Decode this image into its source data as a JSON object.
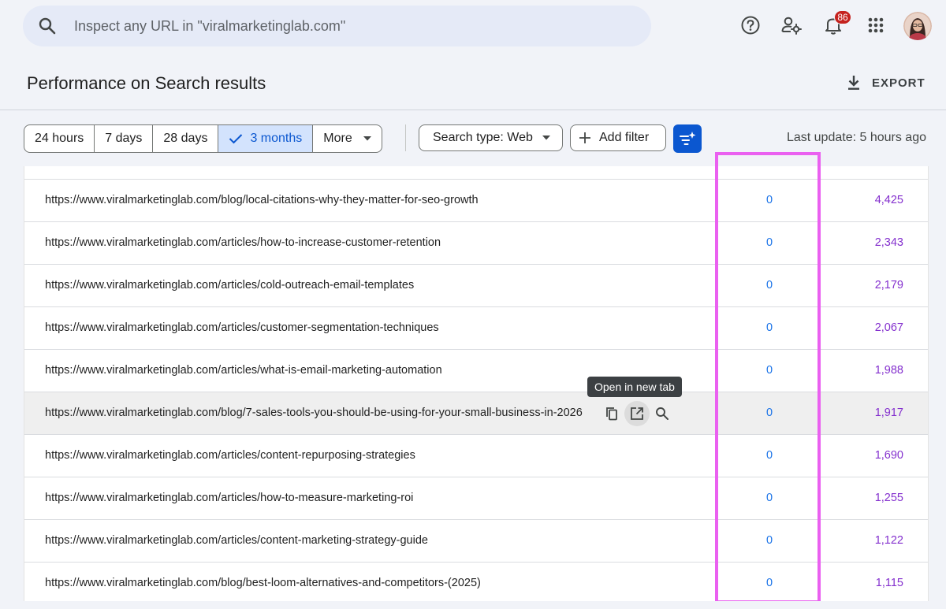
{
  "search": {
    "placeholder": "Inspect any URL in \"viralmarketinglab.com\""
  },
  "notifications": {
    "count": "86"
  },
  "header": {
    "title": "Performance on Search results",
    "export_label": "EXPORT"
  },
  "date_ranges": [
    {
      "label": "24 hours",
      "selected": false
    },
    {
      "label": "7 days",
      "selected": false
    },
    {
      "label": "28 days",
      "selected": false
    },
    {
      "label": "3 months",
      "selected": true
    },
    {
      "label": "More",
      "selected": false
    }
  ],
  "filters": {
    "search_type_label": "Search type: Web",
    "add_filter_label": "Add filter",
    "last_update": "Last update: 5 hours ago"
  },
  "tooltip": "Open in new tab",
  "rows": [
    {
      "url": "https://www.viralmarketinglab.com/blog/local-citations-why-they-matter-for-seo-growth",
      "clicks": "0",
      "impressions": "4,425"
    },
    {
      "url": "https://www.viralmarketinglab.com/articles/how-to-increase-customer-retention",
      "clicks": "0",
      "impressions": "2,343"
    },
    {
      "url": "https://www.viralmarketinglab.com/articles/cold-outreach-email-templates",
      "clicks": "0",
      "impressions": "2,179"
    },
    {
      "url": "https://www.viralmarketinglab.com/articles/customer-segmentation-techniques",
      "clicks": "0",
      "impressions": "2,067"
    },
    {
      "url": "https://www.viralmarketinglab.com/articles/what-is-email-marketing-automation",
      "clicks": "0",
      "impressions": "1,988"
    },
    {
      "url": "https://www.viralmarketinglab.com/blog/7-sales-tools-you-should-be-using-for-your-small-business-in-2026",
      "clicks": "0",
      "impressions": "1,917"
    },
    {
      "url": "https://www.viralmarketinglab.com/articles/content-repurposing-strategies",
      "clicks": "0",
      "impressions": "1,690"
    },
    {
      "url": "https://www.viralmarketinglab.com/articles/how-to-measure-marketing-roi",
      "clicks": "0",
      "impressions": "1,255"
    },
    {
      "url": "https://www.viralmarketinglab.com/articles/content-marketing-strategy-guide",
      "clicks": "0",
      "impressions": "1,122"
    },
    {
      "url": "https://www.viralmarketinglab.com/blog/best-loom-alternatives-and-competitors-(2025)",
      "clicks": "0",
      "impressions": "1,115"
    }
  ],
  "colors": {
    "accent_blue": "#0b57d0",
    "clicks_color": "#1a73e8",
    "impressions_color": "#8430ce",
    "highlight": "#ea60f0",
    "badge_red": "#c5221f"
  },
  "icons": {
    "search": "search-icon",
    "help": "help-icon",
    "manage_users": "manage-users-icon",
    "notifications": "bell-icon",
    "apps": "apps-grid-icon",
    "export": "download-icon",
    "row_copy": "copy-icon",
    "row_open": "open-in-new-icon",
    "row_inspect": "search-icon"
  }
}
